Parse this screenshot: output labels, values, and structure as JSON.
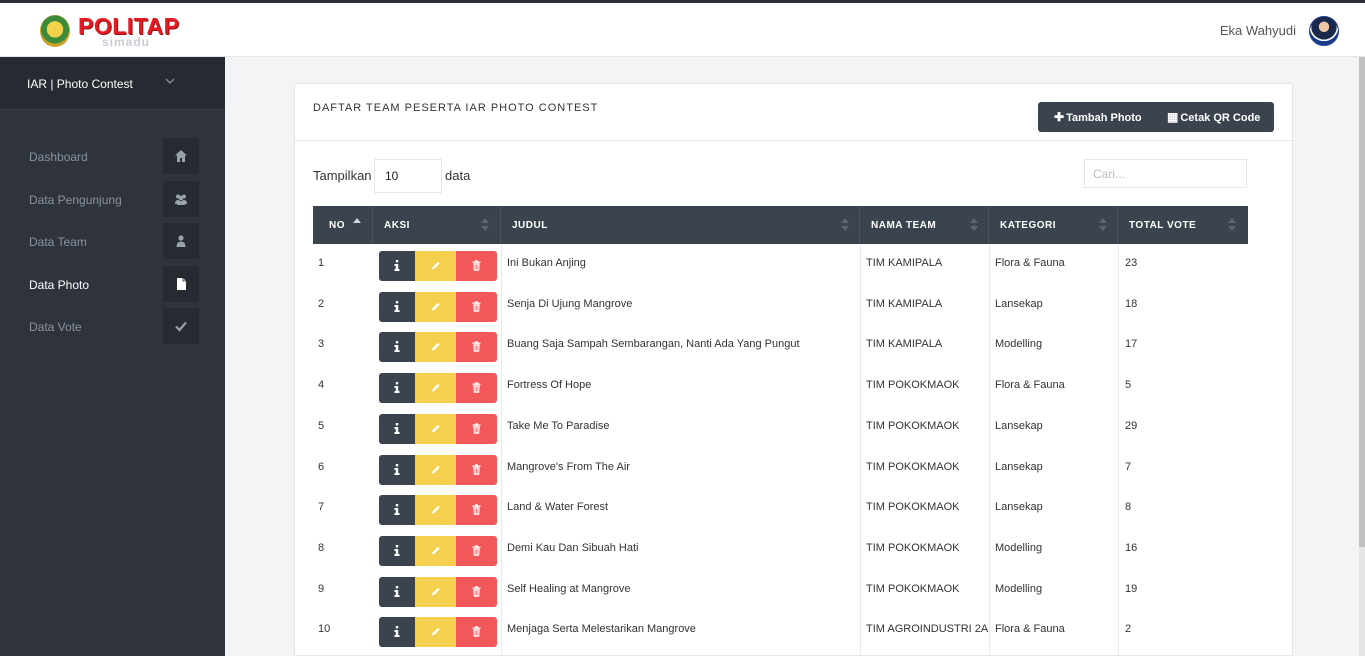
{
  "header": {
    "logo_text": "POLITAP",
    "logo_subtext": "simadu",
    "user_name": "Eka Wahyudi",
    "avatar_icon": "user-avatar"
  },
  "sidebar": {
    "app_switch_label": "IAR | Photo Contest",
    "items": [
      {
        "label": "Dashboard",
        "icon": "home-icon"
      },
      {
        "label": "Data Pengunjung",
        "icon": "users-icon"
      },
      {
        "label": "Data Team",
        "icon": "user-icon"
      },
      {
        "label": "Data Photo",
        "icon": "file-icon",
        "active": true
      },
      {
        "label": "Data Vote",
        "icon": "check-icon"
      }
    ]
  },
  "card": {
    "title": "DAFTAR TEAM PESERTA IAR PHOTO CONTEST",
    "add_button": "Tambah Photo",
    "qr_button": "Cetak QR Code"
  },
  "table_controls": {
    "length_label": "Tampilkan",
    "length_value": "10",
    "length_suffix": "data",
    "search_placeholder": "Cari..."
  },
  "table": {
    "columns": [
      "NO",
      "AKSI",
      "JUDUL",
      "NAMA TEAM",
      "KATEGORI",
      "TOTAL VOTE"
    ],
    "rows": [
      {
        "no": "1",
        "judul": "Ini Bukan Anjing",
        "team": "TIM KAMIPALA",
        "kategori": "Flora & Fauna",
        "vote": "23"
      },
      {
        "no": "2",
        "judul": "Senja Di Ujung Mangrove",
        "team": "TIM KAMIPALA",
        "kategori": "Lansekap",
        "vote": "18"
      },
      {
        "no": "3",
        "judul": "Buang Saja Sampah Sembarangan, Nanti Ada Yang Pungut",
        "team": "TIM KAMIPALA",
        "kategori": "Modelling",
        "vote": "17"
      },
      {
        "no": "4",
        "judul": "Fortress Of Hope",
        "team": "TIM POKOKMAOK",
        "kategori": "Flora & Fauna",
        "vote": "5"
      },
      {
        "no": "5",
        "judul": "Take Me To Paradise",
        "team": "TIM POKOKMAOK",
        "kategori": "Lansekap",
        "vote": "29"
      },
      {
        "no": "6",
        "judul": "Mangrove's From The Air",
        "team": "TIM POKOKMAOK",
        "kategori": "Lansekap",
        "vote": "7"
      },
      {
        "no": "7",
        "judul": "Land & Water Forest",
        "team": "TIM POKOKMAOK",
        "kategori": "Lansekap",
        "vote": "8"
      },
      {
        "no": "8",
        "judul": "Demi Kau Dan Sibuah Hati",
        "team": "TIM POKOKMAOK",
        "kategori": "Modelling",
        "vote": "16"
      },
      {
        "no": "9",
        "judul": "Self Healing at Mangrove",
        "team": "TIM POKOKMAOK",
        "kategori": "Modelling",
        "vote": "19"
      },
      {
        "no": "10",
        "judul": "Menjaga Serta Melestarikan Mangrove",
        "team": "TIM AGROINDUSTRI 2A",
        "kategori": "Flora & Fauna",
        "vote": "2"
      }
    ]
  },
  "colors": {
    "sidebar_bg": "#2e333c",
    "table_header_bg": "#3b434e",
    "action_info": "#3b434e",
    "action_edit": "#f5d04e",
    "action_delete": "#f2575a",
    "logo_red": "#e31b23"
  }
}
